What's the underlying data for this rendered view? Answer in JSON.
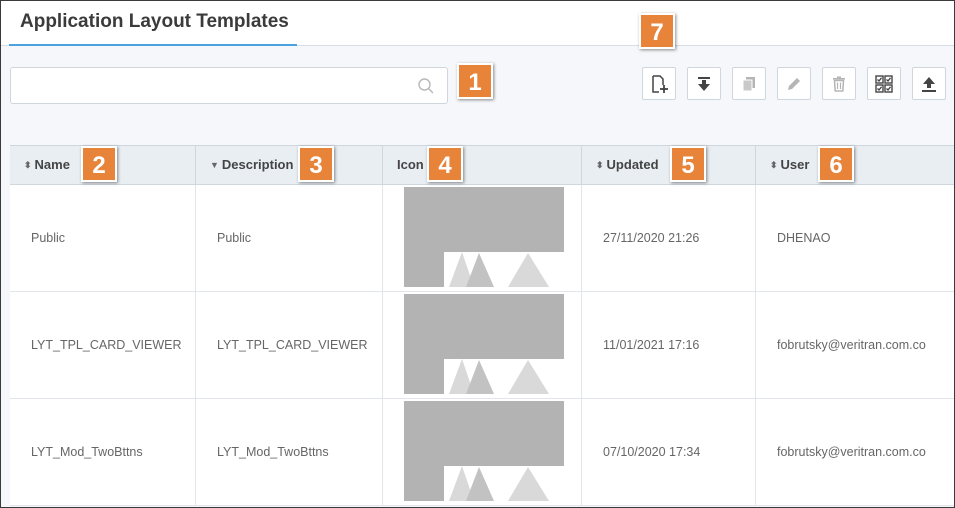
{
  "header": {
    "title": "Application Layout Templates"
  },
  "search": {
    "value": "",
    "placeholder": ""
  },
  "callouts": {
    "search": "1",
    "name": "2",
    "description": "3",
    "icon": "4",
    "updated": "5",
    "user": "6",
    "toolbar": "7"
  },
  "toolbar": {
    "buttons": [
      {
        "icon": "new-document-icon",
        "enabled": true
      },
      {
        "icon": "download-icon",
        "enabled": true
      },
      {
        "icon": "copy-icon",
        "enabled": false
      },
      {
        "icon": "edit-icon",
        "enabled": false
      },
      {
        "icon": "delete-icon",
        "enabled": false
      },
      {
        "icon": "select-all-icon",
        "enabled": true
      },
      {
        "icon": "upload-icon",
        "enabled": true
      }
    ]
  },
  "table": {
    "columns": [
      {
        "label": "Name",
        "sort": "both"
      },
      {
        "label": "Description",
        "sort": "desc"
      },
      {
        "label": "Icon",
        "sort": "none"
      },
      {
        "label": "Updated",
        "sort": "both"
      },
      {
        "label": "User",
        "sort": "both"
      }
    ],
    "rows": [
      {
        "name": "Public",
        "description": "Public",
        "icon": "image-placeholder-icon",
        "updated": "27/11/2020 21:26",
        "user": "DHENAO"
      },
      {
        "name": "LYT_TPL_CARD_VIEWER",
        "description": "LYT_TPL_CARD_VIEWER",
        "icon": "image-placeholder-icon",
        "updated": "11/01/2021 17:16",
        "user": "fobrutsky@veritran.com.co"
      },
      {
        "name": "LYT_Mod_TwoBttns",
        "description": "LYT_Mod_TwoBttns",
        "icon": "image-placeholder-icon",
        "updated": "07/10/2020 17:34",
        "user": "fobrutsky@veritran.com.co"
      }
    ]
  },
  "colors": {
    "accent": "#4aa3df",
    "callout": "#e8833a",
    "header_bg": "#e9eef3",
    "disabled_icon": "#b5b5b5",
    "enabled_icon": "#444444"
  }
}
